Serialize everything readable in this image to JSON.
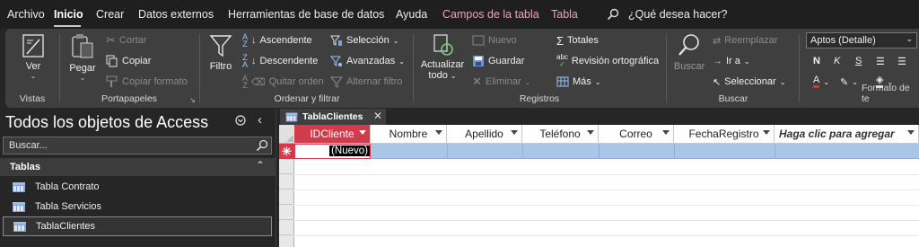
{
  "menu": {
    "items": [
      "Archivo",
      "Inicio",
      "Crear",
      "Datos externos",
      "Herramientas de base de datos",
      "Ayuda",
      "Campos de la tabla",
      "Tabla"
    ],
    "tell_me": "¿Qué desea hacer?"
  },
  "ribbon": {
    "vistas": {
      "view_label": "Ver",
      "group_label": "Vistas"
    },
    "portapapeles": {
      "paste_label": "Pegar",
      "cut_label": "Cortar",
      "copy_label": "Copiar",
      "format_painter_label": "Copiar formato",
      "group_label": "Portapapeles"
    },
    "ordenar": {
      "filter_label": "Filtro",
      "asc_label": "Ascendente",
      "desc_label": "Descendente",
      "clear_sort_label": "Quitar orden",
      "selection_label": "Selección",
      "advanced_label": "Avanzadas",
      "toggle_filter_label": "Alternar filtro",
      "group_label": "Ordenar y filtrar"
    },
    "registros": {
      "refresh_label_1": "Actualizar",
      "refresh_label_2": "todo",
      "new_label": "Nuevo",
      "save_label": "Guardar",
      "delete_label": "Eliminar",
      "totals_label": "Totales",
      "spelling_label": "Revisión ortográfica",
      "more_label": "Más",
      "group_label": "Registros"
    },
    "buscar": {
      "find_label": "Buscar",
      "replace_label": "Reemplazar",
      "goto_label": "Ir a",
      "select_label": "Seleccionar",
      "group_label": "Buscar"
    },
    "formato": {
      "font_value": "Aptos (Detalle)",
      "bold": "N",
      "italic": "K",
      "underline": "S",
      "group_label": "Formato de te"
    }
  },
  "nav": {
    "title": "Todos los objetos de Access",
    "search_placeholder": "Buscar...",
    "section": "Tablas",
    "items": [
      "Tabla Contrato",
      "Tabla Servicios",
      "TablaClientes"
    ]
  },
  "document": {
    "tab_label": "TablaClientes",
    "columns": [
      "IDCliente",
      "Nombre",
      "Apellido",
      "Teléfono",
      "Correo",
      "FechaRegistro",
      "Haga clic para agregar"
    ],
    "new_row_value": "(Nuevo)",
    "new_row_marker": "✳"
  },
  "colors": {
    "accent": "#d13b4a",
    "new_row": "#a8c6e6",
    "ribbon": "#3f3f3f",
    "background": "#262626"
  }
}
